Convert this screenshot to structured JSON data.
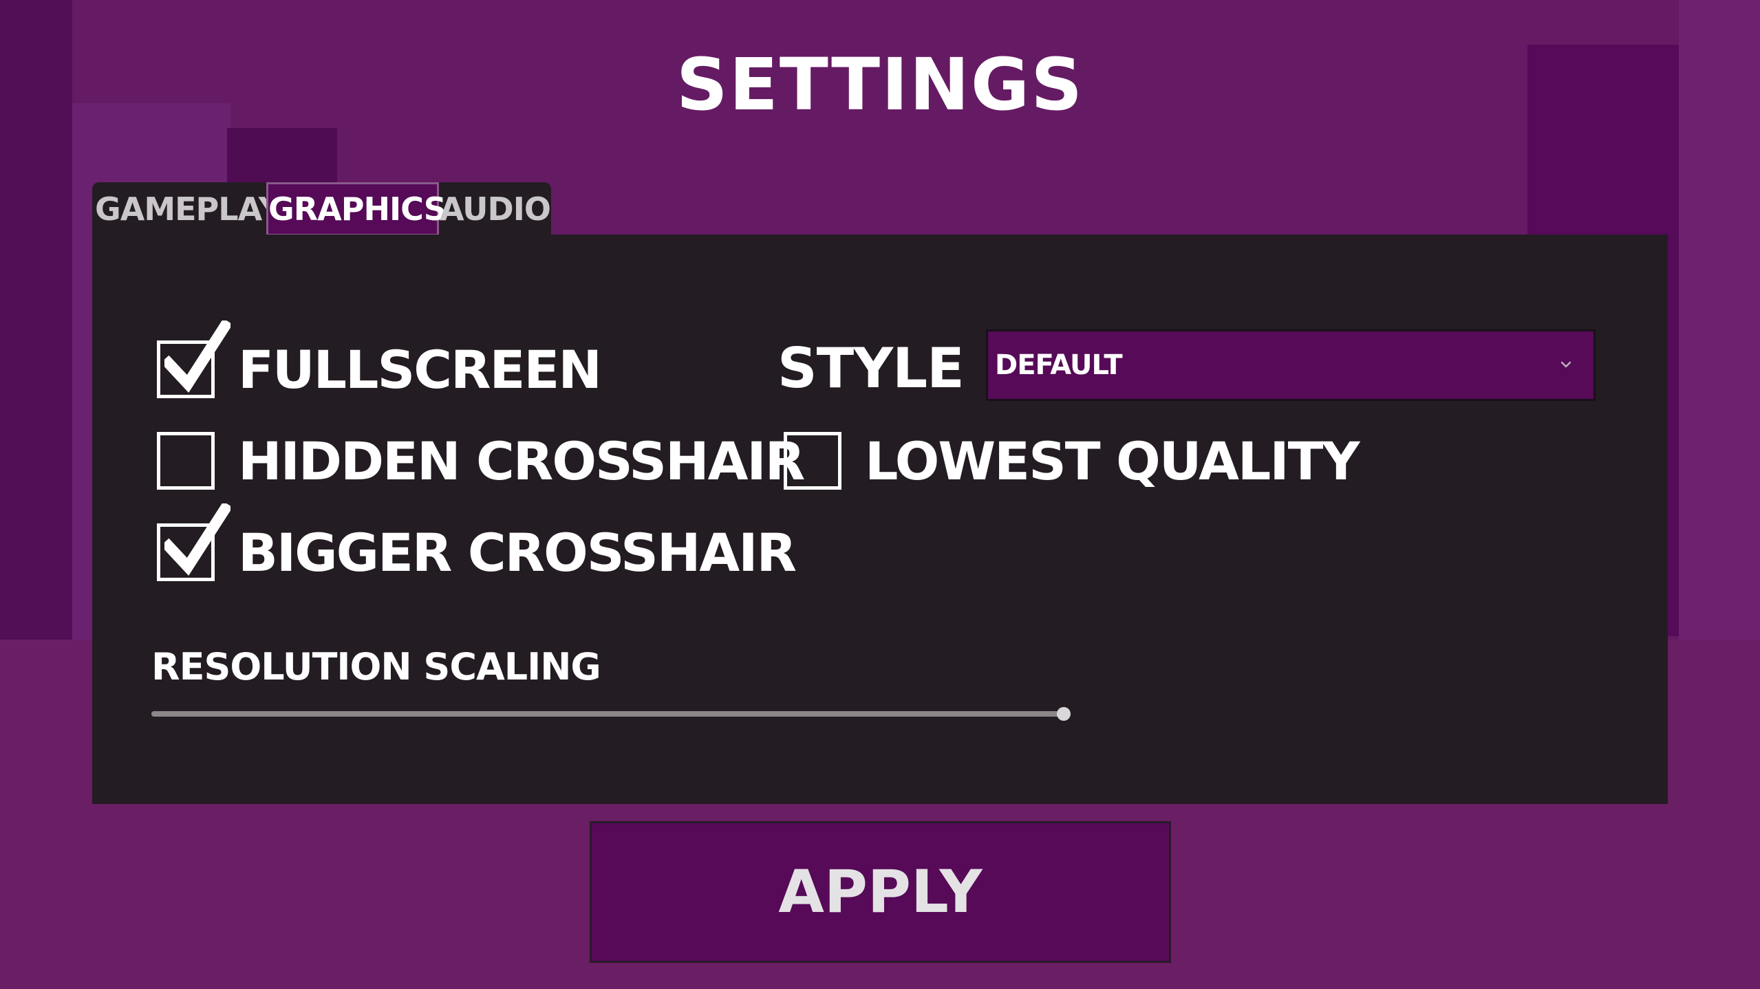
{
  "title": "SETTINGS",
  "tabs": [
    {
      "label": "GAMEPLAY",
      "active": false
    },
    {
      "label": "GRAPHICS",
      "active": true
    },
    {
      "label": "AUDIO",
      "active": false
    }
  ],
  "options": {
    "fullscreen": {
      "label": "FULLSCREEN",
      "checked": true
    },
    "hidden_crosshair": {
      "label": "HIDDEN CROSSHAIR",
      "checked": false
    },
    "bigger_crosshair": {
      "label": "BIGGER CROSSHAIR",
      "checked": true
    },
    "lowest_quality": {
      "label": "LOWEST QUALITY",
      "checked": false
    }
  },
  "style": {
    "label": "STYLE",
    "selected": "DEFAULT",
    "arrow_icon": "chevron-down-icon"
  },
  "resolution_scaling": {
    "label": "RESOLUTION SCALING",
    "value": 1.0
  },
  "apply_label": "APPLY",
  "colors": {
    "background": "#651b63",
    "panel": "#231c22",
    "accent": "#560a57",
    "text": "#ffffff"
  }
}
